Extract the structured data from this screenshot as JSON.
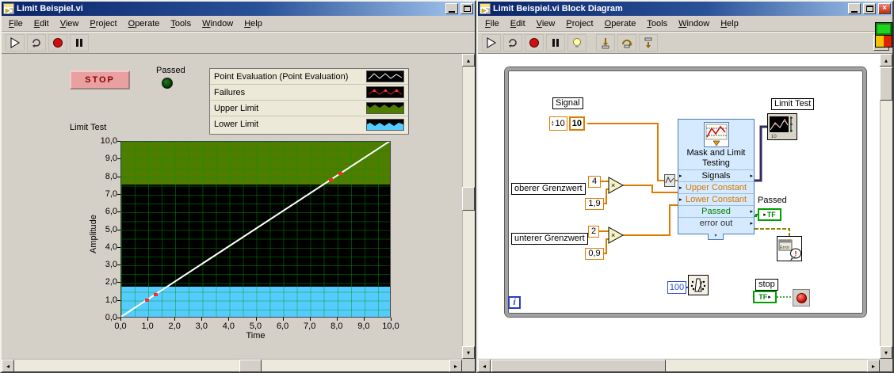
{
  "left_window": {
    "title": "Limit Beispiel.vi",
    "menu": [
      "File",
      "Edit",
      "View",
      "Project",
      "Operate",
      "Tools",
      "Window",
      "Help"
    ],
    "stop_button": "STOP",
    "passed_label": "Passed",
    "legend": {
      "items": [
        {
          "label": "Point Evaluation (Point Evaluation)",
          "icon": "waveform-black"
        },
        {
          "label": "Failures",
          "icon": "waveform-failures"
        },
        {
          "label": "Upper Limit",
          "icon": "band-upper"
        },
        {
          "label": "Lower Limit",
          "icon": "band-lower"
        }
      ]
    },
    "chart": {
      "title": "Limit Test",
      "ylabel": "Amplitude",
      "xlabel": "Time",
      "y_ticks": [
        "10,0",
        "9,0",
        "8,0",
        "7,0",
        "6,0",
        "5,0",
        "4,0",
        "3,0",
        "2,0",
        "1,0",
        "0,0"
      ],
      "x_ticks": [
        "0,0",
        "1,0",
        "2,0",
        "3,0",
        "4,0",
        "5,0",
        "6,0",
        "7,0",
        "8,0",
        "9,0",
        "10,0"
      ]
    },
    "chart_data": {
      "type": "line",
      "title": "Limit Test",
      "xlabel": "Time",
      "ylabel": "Amplitude",
      "xlim": [
        0,
        10
      ],
      "ylim": [
        0,
        10
      ],
      "grid_step": 0.5,
      "grid_color": "rgba(0,155,0,0.45)",
      "plot_bg": "#000000",
      "series": [
        {
          "name": "Point Evaluation",
          "x": [
            0,
            10
          ],
          "y": [
            0,
            10
          ],
          "color": "#ffffff"
        }
      ],
      "failure_points": {
        "points": [
          [
            0.95,
            0.95
          ],
          [
            1.25,
            1.25
          ],
          [
            7.75,
            7.75
          ],
          [
            8.1,
            8.1
          ]
        ],
        "color": "#ff2a2a"
      },
      "upper_limit_band": {
        "from": 7.6,
        "to": 10,
        "color": "#4e7d00"
      },
      "lower_limit_band": {
        "from": 0,
        "to": 1.8,
        "color": "#55ccff"
      }
    }
  },
  "right_window": {
    "title": "Limit Beispiel.vi Block Diagram",
    "menu": [
      "File",
      "Edit",
      "View",
      "Project",
      "Operate",
      "Tools",
      "Window",
      "Help"
    ],
    "help_button": "?",
    "diagram": {
      "signal": {
        "label": "Signal",
        "value": "10",
        "value2": "10"
      },
      "upper": {
        "label": "oberer Grenzwert",
        "const1": "4",
        "const2": "1,9"
      },
      "lower": {
        "label": "unterer Grenzwert",
        "const1": "2",
        "const2": "0,9"
      },
      "multiply_symbol": "×",
      "express_vi": {
        "title": "Mask and Limit Testing",
        "rows": [
          {
            "label": "Signals",
            "color": "#000000",
            "in": true,
            "out": true
          },
          {
            "label": "Upper Constant",
            "color": "#d07800",
            "in": true,
            "out": false
          },
          {
            "label": "Lower Constant",
            "color": "#d07800",
            "in": true,
            "out": false
          },
          {
            "label": "Passed",
            "color": "#008000",
            "in": false,
            "out": true
          },
          {
            "label": "error out",
            "color": "#303030",
            "in": false,
            "out": true
          }
        ]
      },
      "limit_test_label": "Limit Test",
      "passed_label": "Passed",
      "passed_terminal": "TF",
      "stop_label": "stop",
      "stop_terminal": "TF",
      "wait_value": "100",
      "iteration_label": "i",
      "error_icon_text": "Error"
    }
  }
}
